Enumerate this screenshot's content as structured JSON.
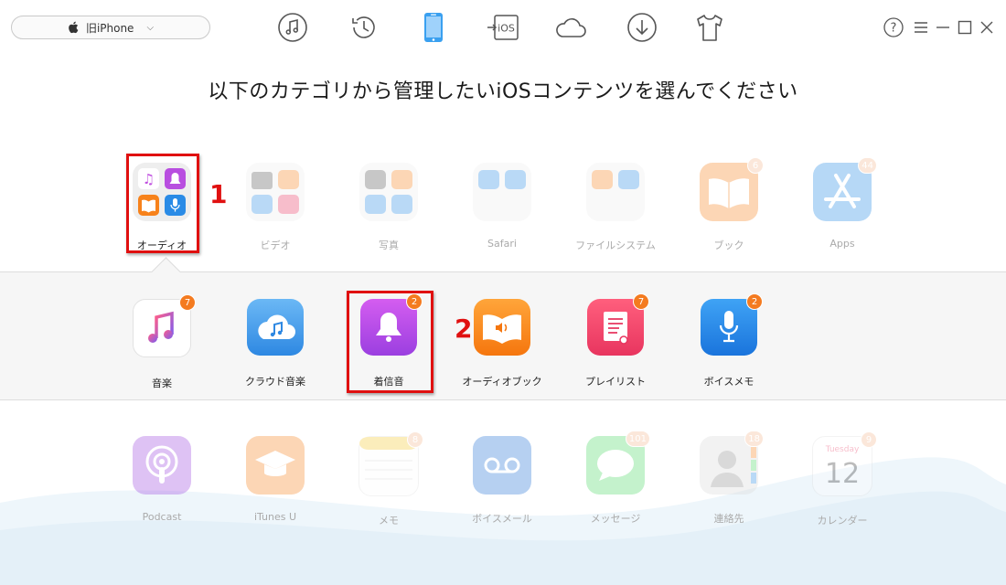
{
  "device": {
    "name": "旧iPhone"
  },
  "toolbar": {
    "icons": [
      "music-icon",
      "history-icon",
      "iphone-icon",
      "ios-transfer-icon",
      "icloud-icon",
      "download-icon",
      "tshirt-icon"
    ],
    "ios_label": "iOS"
  },
  "window": {
    "help": "?"
  },
  "heading": "以下のカテゴリから管理したいiOSコンテンツを選んでください",
  "categories": [
    {
      "label": "オーディオ",
      "badge": ""
    },
    {
      "label": "ビデオ",
      "badge": ""
    },
    {
      "label": "写真",
      "badge": ""
    },
    {
      "label": "Safari",
      "badge": ""
    },
    {
      "label": "ファイルシステム",
      "badge": ""
    },
    {
      "label": "ブック",
      "badge": "6"
    },
    {
      "label": "Apps",
      "badge": "44"
    }
  ],
  "audio_items": [
    {
      "label": "音楽",
      "badge": "7"
    },
    {
      "label": "クラウド音楽",
      "badge": ""
    },
    {
      "label": "着信音",
      "badge": "2"
    },
    {
      "label": "オーディオブック",
      "badge": ""
    },
    {
      "label": "プレイリスト",
      "badge": "7"
    },
    {
      "label": "ボイスメモ",
      "badge": "2"
    }
  ],
  "more_categories": [
    {
      "label": "Podcast",
      "badge": ""
    },
    {
      "label": "iTunes U",
      "badge": ""
    },
    {
      "label": "メモ",
      "badge": "8"
    },
    {
      "label": "ボイスメール",
      "badge": ""
    },
    {
      "label": "メッセージ",
      "badge": "101"
    },
    {
      "label": "連絡先",
      "badge": "18"
    },
    {
      "label": "カレンダー",
      "badge": "9"
    }
  ],
  "calendar_icon": {
    "day_name": "Tuesday",
    "date": "12"
  },
  "annotations": {
    "step1": "1",
    "step2": "2"
  },
  "colors": {
    "accent_blue": "#3aa0f0",
    "highlight_red": "#e01010",
    "badge_orange": "#f47b20"
  }
}
